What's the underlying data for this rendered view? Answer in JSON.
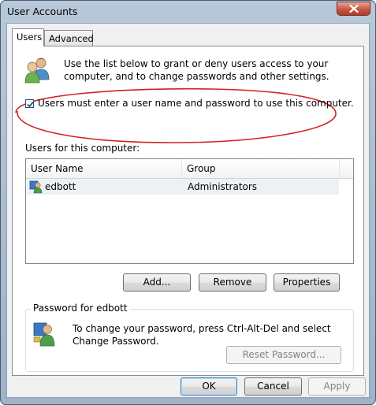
{
  "window": {
    "title": "User Accounts"
  },
  "tabs": [
    {
      "label": "Users",
      "active": true
    },
    {
      "label": "Advanced",
      "active": false
    }
  ],
  "users_tab": {
    "info_text": "Use the list below to grant or deny users access to your computer, and to change passwords and other settings.",
    "require_password_checkbox": {
      "label": "Users must enter a user name and password to use this computer.",
      "checked": true
    },
    "users_list_label": "Users for this computer:",
    "columns": [
      "User Name",
      "Group"
    ],
    "rows": [
      {
        "user_name": "edbott",
        "group": "Administrators",
        "selected": true
      }
    ],
    "buttons": {
      "add": "Add...",
      "remove": "Remove",
      "properties": "Properties"
    },
    "password_group": {
      "title": "Password for edbott",
      "text": "To change your password, press Ctrl-Alt-Del and select Change Password.",
      "reset_button": "Reset Password..."
    }
  },
  "dialog_buttons": {
    "ok": "OK",
    "cancel": "Cancel",
    "apply": "Apply"
  },
  "annotation": {
    "ellipse_color": "#d42020"
  },
  "icons": {
    "users": "users-icon",
    "user": "user-icon",
    "password": "user-key-icon",
    "close": "close-icon"
  }
}
